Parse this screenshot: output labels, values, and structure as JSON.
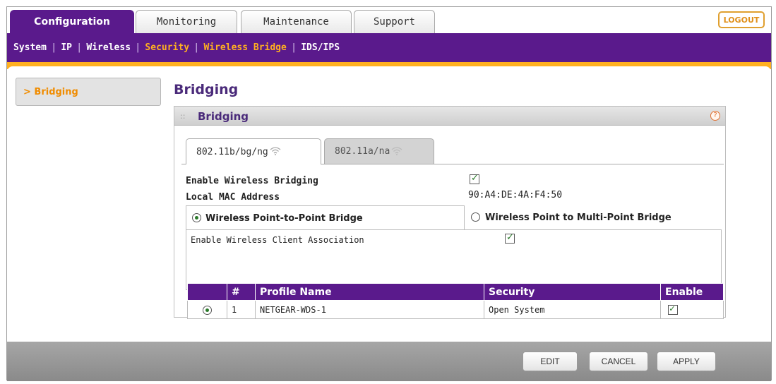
{
  "top_tabs": [
    "Configuration",
    "Monitoring",
    "Maintenance",
    "Support"
  ],
  "logout_label": "LOGOUT",
  "subnav": [
    "System",
    "IP",
    "Wireless",
    "Security",
    "Wireless Bridge",
    "IDS/IPS"
  ],
  "sidebar": {
    "items": [
      {
        "label": "> Bridging"
      }
    ]
  },
  "page": {
    "title": "Bridging"
  },
  "panel": {
    "title": "Bridging",
    "help_symbol": "?",
    "radio_tabs": [
      "802.11b/bg/ng",
      "802.11a/na"
    ],
    "enable_wireless_bridging_label": "Enable Wireless Bridging",
    "enable_wireless_bridging": true,
    "local_mac_label": "Local MAC Address",
    "local_mac_value": "90:A4:DE:4A:F4:50",
    "mode_p2p_label": "Wireless Point-to-Point Bridge",
    "mode_p2mp_label": "Wireless Point to Multi-Point Bridge",
    "selected_mode": "p2p",
    "client_assoc_label": "Enable Wireless Client Association",
    "client_assoc": true
  },
  "table": {
    "headers": [
      "",
      "#",
      "Profile Name",
      "Security",
      "Enable"
    ],
    "rows": [
      {
        "num": "1",
        "profile": "NETGEAR-WDS-1",
        "security": "Open System",
        "enabled": true,
        "selected": true
      }
    ]
  },
  "footer": {
    "edit": "EDIT",
    "cancel": "CANCEL",
    "apply": "APPLY"
  },
  "colors": {
    "brand_purple": "#5a1a8c",
    "accent_orange": "#ffb020"
  }
}
